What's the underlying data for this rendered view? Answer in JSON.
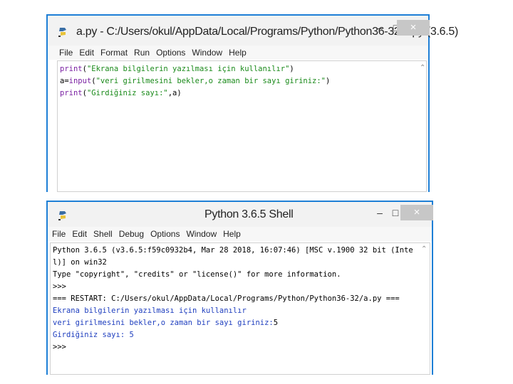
{
  "editor_window": {
    "title": "a.py - C:/Users/okul/AppData/Local/Programs/Python/Python36-32/a.py (3.6.5)",
    "icon": "idle-python-icon",
    "minimize": "–",
    "maximize": "□",
    "close": "×",
    "menu": [
      "File",
      "Edit",
      "Format",
      "Run",
      "Options",
      "Window",
      "Help"
    ],
    "code": [
      [
        {
          "t": "print",
          "c": "kw"
        },
        {
          "t": "(",
          "c": "plain"
        },
        {
          "t": "\"Ekrana bilgilerin yazılması için kullanılır\"",
          "c": "str"
        },
        {
          "t": ")",
          "c": "plain"
        }
      ],
      [
        {
          "t": "a=",
          "c": "plain"
        },
        {
          "t": "input",
          "c": "kw"
        },
        {
          "t": "(",
          "c": "plain"
        },
        {
          "t": "\"veri girilmesini bekler,o zaman bir sayı giriniz:\"",
          "c": "str"
        },
        {
          "t": ")",
          "c": "plain"
        }
      ],
      [
        {
          "t": "print",
          "c": "kw"
        },
        {
          "t": "(",
          "c": "plain"
        },
        {
          "t": "\"Girdiğiniz sayı:\"",
          "c": "str"
        },
        {
          "t": ",a)",
          "c": "plain"
        }
      ]
    ]
  },
  "shell_window": {
    "title": "Python 3.6.5 Shell",
    "icon": "idle-python-icon",
    "minimize": "–",
    "maximize": "□",
    "close": "×",
    "menu": [
      "File",
      "Edit",
      "Shell",
      "Debug",
      "Options",
      "Window",
      "Help"
    ],
    "lines": [
      {
        "t": "Python 3.6.5 (v3.6.5:f59c0932b4, Mar 28 2018, 16:07:46) [MSC v.1900 32 bit (Inte",
        "c": "plain"
      },
      {
        "t": "l)] on win32",
        "c": "plain"
      },
      {
        "t": "Type \"copyright\", \"credits\" or \"license()\" for more information.",
        "c": "plain"
      },
      {
        "t": ">>>",
        "c": "plain"
      },
      {
        "t": "=== RESTART: C:/Users/okul/AppData/Local/Programs/Python/Python36-32/a.py ===",
        "c": "plain"
      },
      {
        "t": "Ekrana bilgilerin yazılması için kullanılır",
        "c": "out"
      },
      {
        "t": "veri girilmesini bekler,o zaman bir sayı giriniz:",
        "c": "out",
        "after": {
          "t": "5",
          "c": "plain"
        }
      },
      {
        "t": "Girdiğiniz sayı: 5",
        "c": "out"
      },
      {
        "t": ">>>",
        "c": "plain"
      }
    ]
  }
}
